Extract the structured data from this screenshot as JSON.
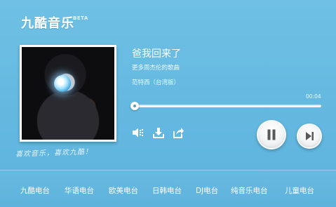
{
  "header": {
    "app_name": "九酷音乐",
    "beta": "BETA"
  },
  "slogan": "喜欢音乐，喜欢九酷！",
  "now_playing": {
    "title": "爸我回来了",
    "more_link": "更多周杰伦的歌曲",
    "album": "范特西（台湾版）",
    "elapsed": "00:04",
    "progress_fraction": 0.0
  },
  "controls": {
    "volume_icon": "volume-icon",
    "download_icon": "download-icon",
    "share_icon": "share-icon",
    "pause_icon": "pause-icon",
    "next_icon": "next-icon"
  },
  "stations": [
    {
      "label": "九酷电台"
    },
    {
      "label": "华语电台"
    },
    {
      "label": "欧美电台"
    },
    {
      "label": "日韩电台"
    },
    {
      "label": "DJ电台"
    },
    {
      "label": "纯音乐电台"
    },
    {
      "label": "儿童电台"
    }
  ]
}
